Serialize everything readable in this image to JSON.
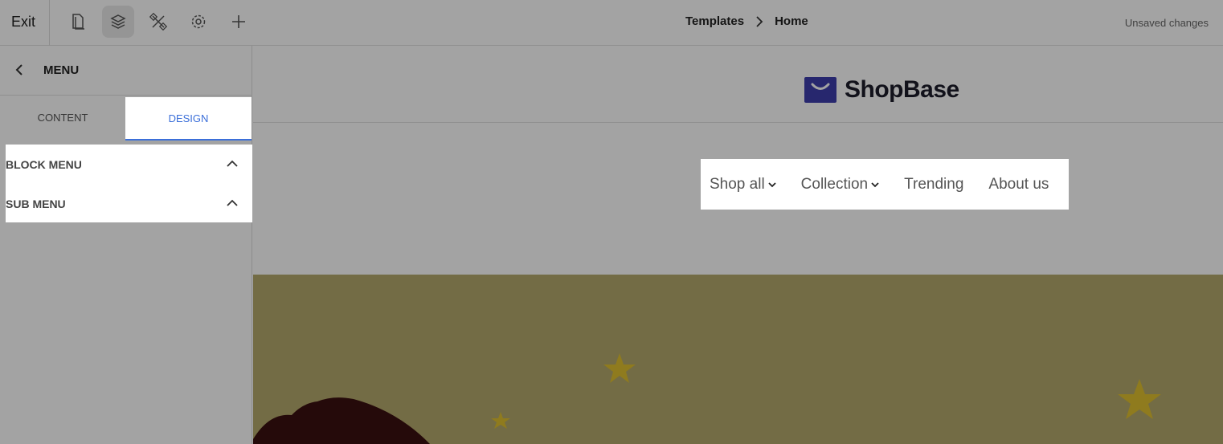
{
  "topbar": {
    "exit_label": "Exit",
    "icons": [
      "page-icon",
      "layers-icon",
      "tools-icon",
      "gear-icon",
      "plus-icon"
    ],
    "breadcrumb": [
      "Templates",
      "Home"
    ],
    "status": "Unsaved changes"
  },
  "sidebar": {
    "title": "MENU",
    "tabs": [
      {
        "label": "CONTENT",
        "active": false
      },
      {
        "label": "DESIGN",
        "active": true
      }
    ],
    "sections": [
      {
        "label": "BLOCK MENU",
        "expanded": true
      },
      {
        "label": "SUB MENU",
        "expanded": true
      }
    ]
  },
  "preview": {
    "logo_text": "ShopBase",
    "nav": [
      {
        "label": "Shop all",
        "has_dropdown": true
      },
      {
        "label": "Collection",
        "has_dropdown": true
      },
      {
        "label": "Trending",
        "has_dropdown": false
      },
      {
        "label": "About us",
        "has_dropdown": false
      }
    ]
  },
  "colors": {
    "accent": "#3b6fd9",
    "hero_bg": "#b4a96c",
    "star": "#e0c030",
    "logo_bag": "#3d3dac"
  }
}
